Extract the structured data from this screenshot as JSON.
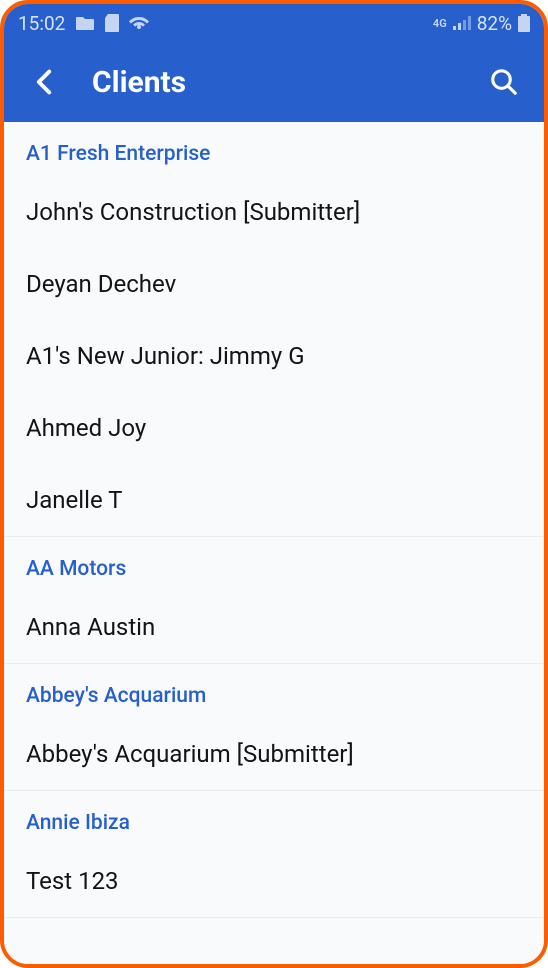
{
  "status_bar": {
    "time": "15:02",
    "network_label": "4G",
    "battery_percent": "82%"
  },
  "header": {
    "title": "Clients"
  },
  "groups": [
    {
      "name": "A1 Fresh Enterprise",
      "clients": [
        "John's Construction [Submitter]",
        "Deyan Dechev",
        "A1's New Junior: Jimmy G",
        "Ahmed Joy",
        "Janelle T"
      ]
    },
    {
      "name": "AA Motors",
      "clients": [
        "Anna Austin"
      ]
    },
    {
      "name": "Abbey's Acquarium",
      "clients": [
        "Abbey's Acquarium [Submitter]"
      ]
    },
    {
      "name": "Annie Ibiza",
      "clients": [
        "Test 123"
      ]
    }
  ]
}
